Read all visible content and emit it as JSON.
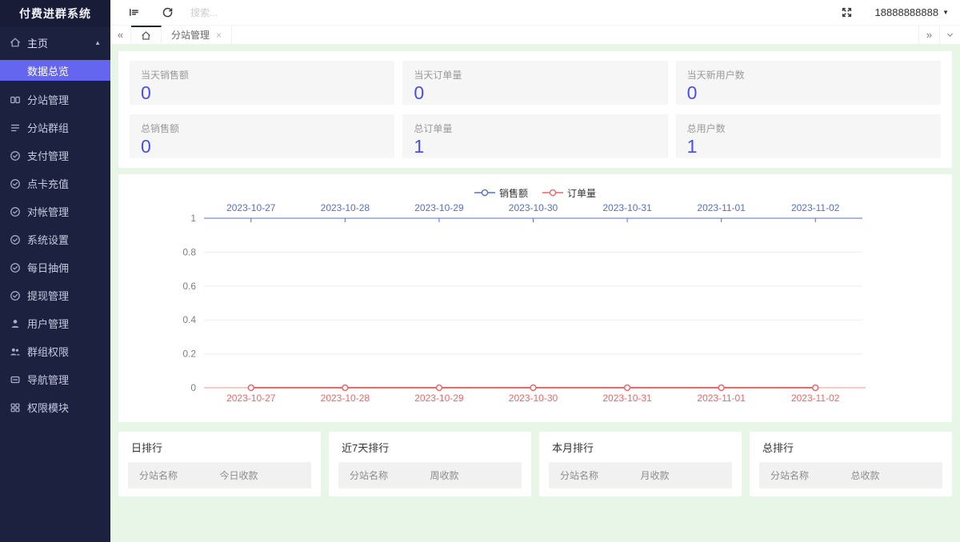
{
  "app": {
    "title": "付费进群系统"
  },
  "sidebar": {
    "items": [
      {
        "label": "主页"
      },
      {
        "label": "数据总览"
      },
      {
        "label": "分站管理"
      },
      {
        "label": "分站群组"
      },
      {
        "label": "支付管理"
      },
      {
        "label": "点卡充值"
      },
      {
        "label": "对帐管理"
      },
      {
        "label": "系统设置"
      },
      {
        "label": "每日抽佣"
      },
      {
        "label": "提现管理"
      },
      {
        "label": "用户管理"
      },
      {
        "label": "群组权限"
      },
      {
        "label": "导航管理"
      },
      {
        "label": "权限模块"
      }
    ]
  },
  "topbar": {
    "search_placeholder": "搜索...",
    "user_phone": "18888888888"
  },
  "tabs": {
    "subsite_tab_label": "分站管理",
    "close_glyph": "×",
    "collapse_left": "«",
    "collapse_right": "»"
  },
  "stats": {
    "cards": [
      {
        "label": "当天销售额",
        "value": "0"
      },
      {
        "label": "当天订单量",
        "value": "0"
      },
      {
        "label": "当天新用户数",
        "value": "0"
      },
      {
        "label": "总销售额",
        "value": "0"
      },
      {
        "label": "总订单量",
        "value": "1"
      },
      {
        "label": "总用户数",
        "value": "1"
      }
    ]
  },
  "chart_data": {
    "type": "line",
    "x": [
      "2023-10-27",
      "2023-10-28",
      "2023-10-29",
      "2023-10-30",
      "2023-10-31",
      "2023-11-01",
      "2023-11-02"
    ],
    "series": [
      {
        "name": "销售额",
        "color": "#5470c6",
        "axis": "top",
        "values": [
          0,
          0,
          0,
          0,
          0,
          0,
          0
        ]
      },
      {
        "name": "订单量",
        "color": "#ee6666",
        "axis": "bottom",
        "values": [
          0,
          0,
          0,
          0,
          0,
          0,
          0
        ]
      }
    ],
    "ylim": [
      0,
      1
    ],
    "y_ticks": [
      0,
      0.2,
      0.4,
      0.6,
      0.8,
      1
    ],
    "grid": true,
    "legend_position": "top",
    "title": "",
    "xlabel": "",
    "ylabel": ""
  },
  "rankings": [
    {
      "title": "日排行",
      "col1": "分站名称",
      "col2": "今日收款"
    },
    {
      "title": "近7天排行",
      "col1": "分站名称",
      "col2": "周收款"
    },
    {
      "title": "本月排行",
      "col1": "分站名称",
      "col2": "月收款"
    },
    {
      "title": "总排行",
      "col1": "分站名称",
      "col2": "总收款"
    }
  ],
  "colors": {
    "sidebar_bg": "#1d2140",
    "accent_active": "#6466ef",
    "stat_value_blue": "#4a4df0",
    "series_sales_blue": "#5470c6",
    "series_orders_red": "#ee6666",
    "content_bg": "#e7f6e7",
    "grid_line": "#ececf2",
    "axis_label_gray": "#7b7f8a"
  }
}
